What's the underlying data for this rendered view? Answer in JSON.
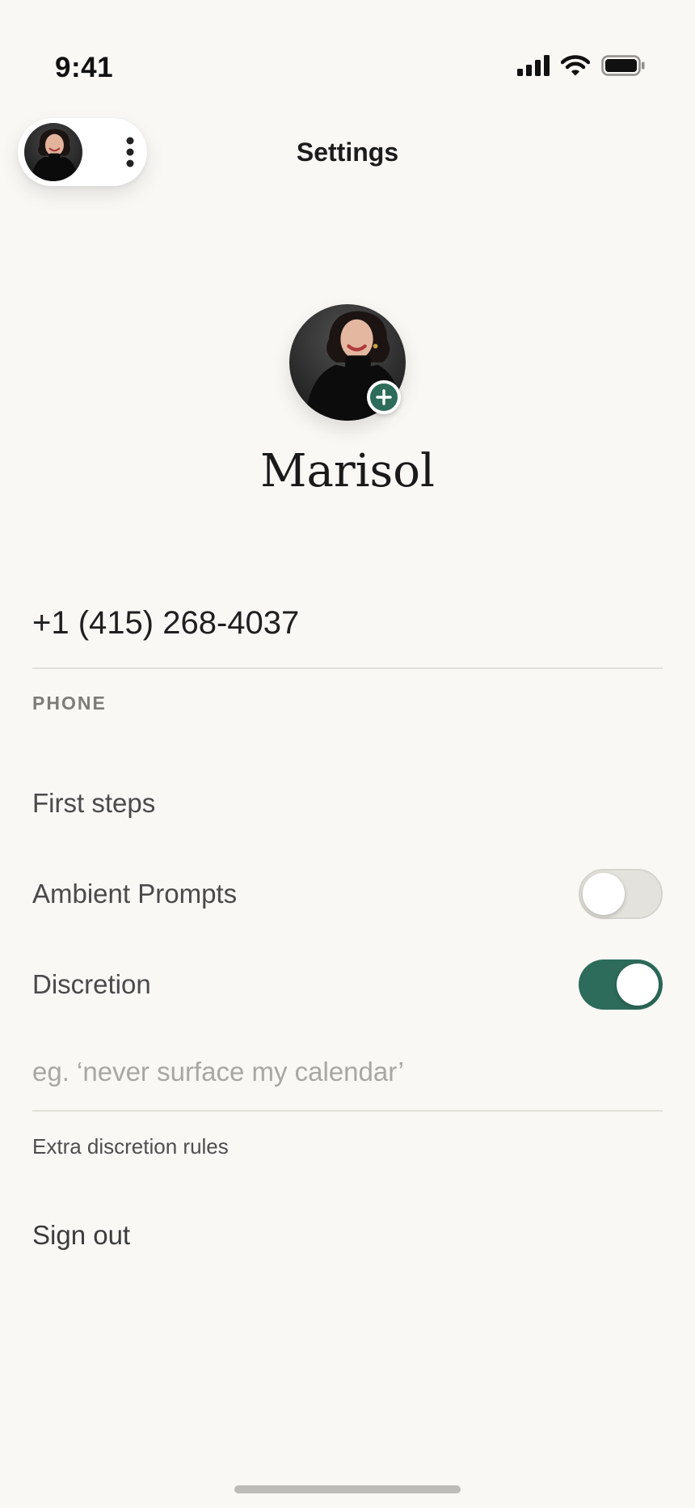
{
  "status_bar": {
    "time": "9:41",
    "icons": [
      "cellular-signal-icon",
      "wifi-icon",
      "battery-icon"
    ]
  },
  "header": {
    "title": "Settings",
    "account_menu_icon": "more-vertical-icon"
  },
  "profile": {
    "name": "Marisol",
    "add_photo_icon": "plus-icon"
  },
  "phone": {
    "value": "+1 (415) 268-4037",
    "caption": "PHONE"
  },
  "rows": {
    "first_steps": "First steps",
    "ambient_prompts": {
      "label": "Ambient Prompts",
      "enabled": false
    },
    "discretion": {
      "label": "Discretion",
      "enabled": true
    }
  },
  "discretion_rules": {
    "value": "",
    "placeholder": "eg. ‘never surface my calendar’",
    "caption": "Extra discretion rules"
  },
  "sign_out": "Sign out",
  "colors": {
    "background": "#f9f8f5",
    "accent": "#2d6b5a",
    "toggle_off": "#e4e2dc",
    "divider": "#e2e0da"
  }
}
